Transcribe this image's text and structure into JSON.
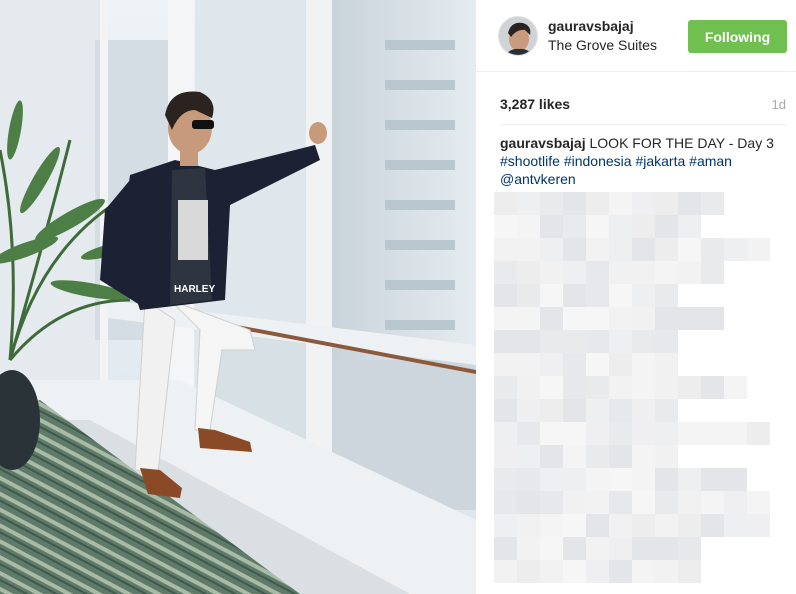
{
  "post": {
    "username": "gauravsbajaj",
    "location": "The Grove Suites",
    "follow_label": "Following",
    "likes": "3,287 likes",
    "time_ago": "1d",
    "caption": {
      "username": "gauravsbajaj",
      "text": " LOOK FOR THE DAY - Day 3 ",
      "tags": [
        "#shootlife",
        "#indonesia",
        "#jakarta",
        "#aman"
      ],
      "mention": "@antvkeren"
    },
    "photo_shirt_text": "HARLEY"
  },
  "colors": {
    "follow_button": "#70c050",
    "tag_link": "#003569",
    "muted_text": "#a5a7aa"
  },
  "icons": [
    "avatar"
  ]
}
